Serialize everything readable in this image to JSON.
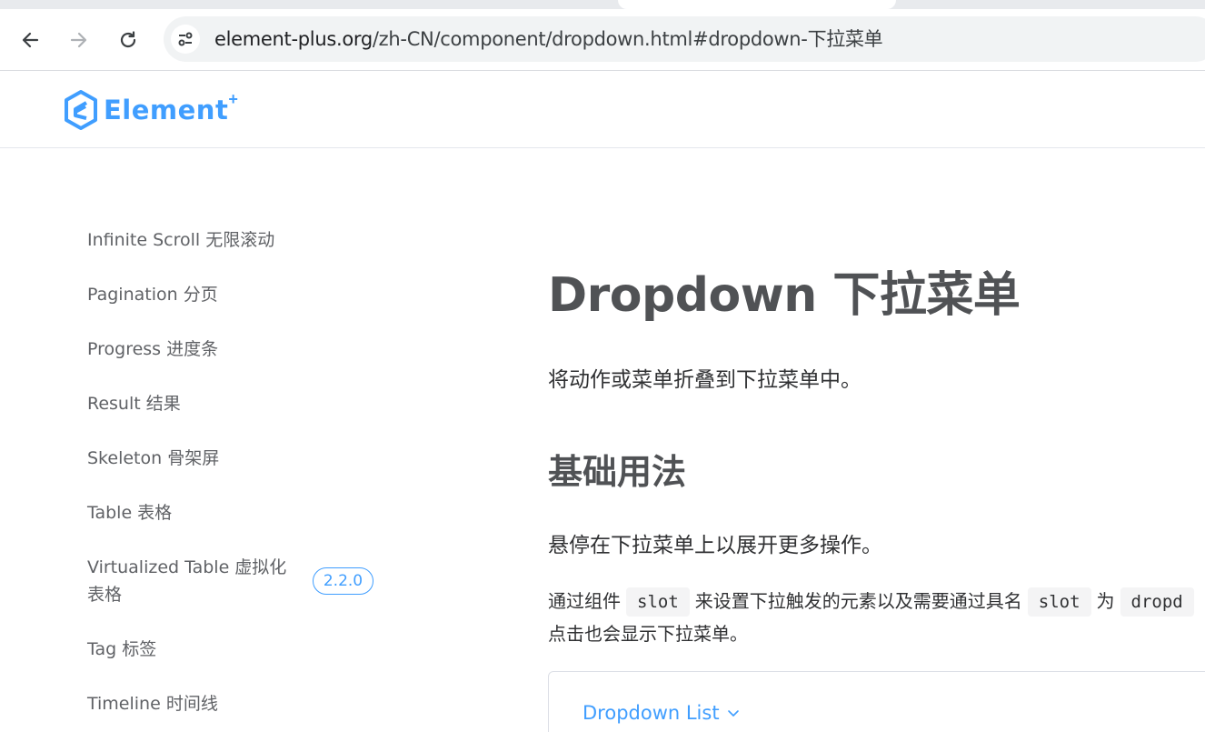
{
  "browser": {
    "url_host": "element-plus.org",
    "url_path": "/zh-CN/component/dropdown.html#dropdown-下拉菜单"
  },
  "site": {
    "logo_text": "Element",
    "logo_sup": "+"
  },
  "sidebar": {
    "items": [
      {
        "label": "Infinite Scroll 无限滚动"
      },
      {
        "label": "Pagination 分页"
      },
      {
        "label": "Progress 进度条"
      },
      {
        "label": "Result 结果"
      },
      {
        "label": "Skeleton 骨架屏"
      },
      {
        "label": "Table 表格"
      },
      {
        "label": "Virtualized Table 虚拟化表格",
        "line1": "Virtualized Table 虚拟化",
        "line2": "表格",
        "badge": "2.2.0"
      },
      {
        "label": "Tag 标签"
      },
      {
        "label": "Timeline 时间线"
      }
    ]
  },
  "main": {
    "title": "Dropdown 下拉菜单",
    "lead": "将动作或菜单折叠到下拉菜单中。",
    "section_title": "基础用法",
    "section_desc": "悬停在下拉菜单上以展开更多操作。",
    "para": {
      "part1": "通过组件",
      "code1": "slot",
      "part2": "来设置下拉触发的元素以及需要通过具名",
      "code2": "slot",
      "part3": "为",
      "code3": "dropd",
      "line2": "点击也会显示下拉菜单。"
    },
    "demo": {
      "dropdown_label": "Dropdown List"
    }
  },
  "colors": {
    "accent": "#409eff",
    "title": "#505255",
    "text": "#303133",
    "sidebar_text": "#606266"
  }
}
